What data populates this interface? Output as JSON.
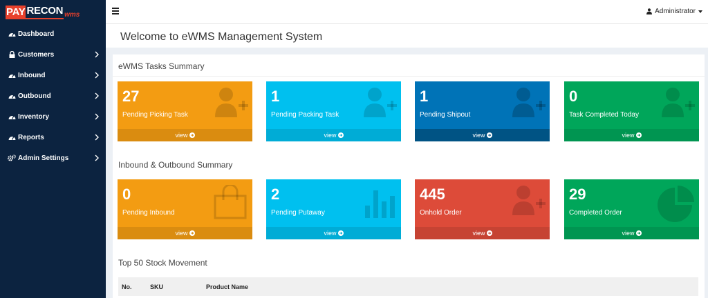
{
  "logo": {
    "part1": "PAY",
    "part2": "RECON",
    "part3": "wms"
  },
  "sidebar": {
    "items": [
      {
        "label": "Dashboard",
        "icon": "dashboard-icon"
      },
      {
        "label": "Customers",
        "icon": "lock-icon"
      },
      {
        "label": "Inbound",
        "icon": "dashboard-icon"
      },
      {
        "label": "Outbound",
        "icon": "dashboard-icon"
      },
      {
        "label": "Inventory",
        "icon": "dashboard-icon"
      },
      {
        "label": "Reports",
        "icon": "dashboard-icon"
      },
      {
        "label": "Admin Settings",
        "icon": "gears-icon"
      }
    ]
  },
  "topbar": {
    "user": "Administrator"
  },
  "header": {
    "title": "Welcome to eWMS Management System"
  },
  "tasks": {
    "title": "eWMS Tasks Summary",
    "boxes": [
      {
        "value": "27",
        "label": "Pending Picking Task",
        "link": "view",
        "color": "#f39c12",
        "icon": "user-plus-icon"
      },
      {
        "value": "1",
        "label": "Pending Packing Task",
        "link": "view",
        "color": "#00c0ef",
        "icon": "user-plus-icon"
      },
      {
        "value": "1",
        "label": "Pending Shipout",
        "link": "view",
        "color": "#0073b7",
        "icon": "user-plus-icon"
      },
      {
        "value": "0",
        "label": "Task Completed Today",
        "link": "view",
        "color": "#00a65a",
        "icon": "user-plus-icon"
      }
    ]
  },
  "inout": {
    "title": "Inbound & Outbound Summary",
    "boxes": [
      {
        "value": "0",
        "label": "Pending Inbound",
        "link": "view",
        "color": "#f39c12",
        "icon": "shopping-bag-icon"
      },
      {
        "value": "2",
        "label": "Pending Putaway",
        "link": "view",
        "color": "#00c0ef",
        "icon": "bar-chart-icon"
      },
      {
        "value": "445",
        "label": "Onhold Order",
        "link": "view",
        "color": "#dd4b39",
        "icon": "user-plus-icon"
      },
      {
        "value": "29",
        "label": "Completed Order",
        "link": "view",
        "color": "#00a65a",
        "icon": "pie-chart-icon"
      }
    ]
  },
  "stock": {
    "title": "Top 50 Stock Movement",
    "columns": [
      "No.",
      "SKU",
      "Product Name"
    ]
  }
}
